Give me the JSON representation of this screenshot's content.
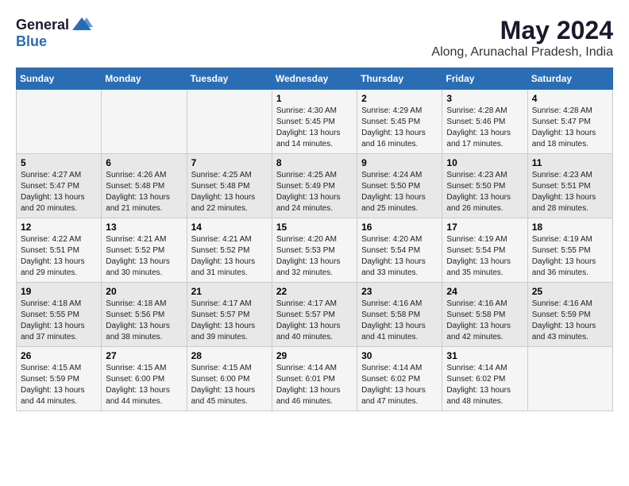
{
  "header": {
    "logo_general": "General",
    "logo_blue": "Blue",
    "month_title": "May 2024",
    "location": "Along, Arunachal Pradesh, India"
  },
  "days_of_week": [
    "Sunday",
    "Monday",
    "Tuesday",
    "Wednesday",
    "Thursday",
    "Friday",
    "Saturday"
  ],
  "weeks": [
    {
      "days": [
        {
          "number": "",
          "sunrise": "",
          "sunset": "",
          "daylight": ""
        },
        {
          "number": "",
          "sunrise": "",
          "sunset": "",
          "daylight": ""
        },
        {
          "number": "",
          "sunrise": "",
          "sunset": "",
          "daylight": ""
        },
        {
          "number": "1",
          "sunrise": "Sunrise: 4:30 AM",
          "sunset": "Sunset: 5:45 PM",
          "daylight": "Daylight: 13 hours and 14 minutes."
        },
        {
          "number": "2",
          "sunrise": "Sunrise: 4:29 AM",
          "sunset": "Sunset: 5:45 PM",
          "daylight": "Daylight: 13 hours and 16 minutes."
        },
        {
          "number": "3",
          "sunrise": "Sunrise: 4:28 AM",
          "sunset": "Sunset: 5:46 PM",
          "daylight": "Daylight: 13 hours and 17 minutes."
        },
        {
          "number": "4",
          "sunrise": "Sunrise: 4:28 AM",
          "sunset": "Sunset: 5:47 PM",
          "daylight": "Daylight: 13 hours and 18 minutes."
        }
      ]
    },
    {
      "days": [
        {
          "number": "5",
          "sunrise": "Sunrise: 4:27 AM",
          "sunset": "Sunset: 5:47 PM",
          "daylight": "Daylight: 13 hours and 20 minutes."
        },
        {
          "number": "6",
          "sunrise": "Sunrise: 4:26 AM",
          "sunset": "Sunset: 5:48 PM",
          "daylight": "Daylight: 13 hours and 21 minutes."
        },
        {
          "number": "7",
          "sunrise": "Sunrise: 4:25 AM",
          "sunset": "Sunset: 5:48 PM",
          "daylight": "Daylight: 13 hours and 22 minutes."
        },
        {
          "number": "8",
          "sunrise": "Sunrise: 4:25 AM",
          "sunset": "Sunset: 5:49 PM",
          "daylight": "Daylight: 13 hours and 24 minutes."
        },
        {
          "number": "9",
          "sunrise": "Sunrise: 4:24 AM",
          "sunset": "Sunset: 5:50 PM",
          "daylight": "Daylight: 13 hours and 25 minutes."
        },
        {
          "number": "10",
          "sunrise": "Sunrise: 4:23 AM",
          "sunset": "Sunset: 5:50 PM",
          "daylight": "Daylight: 13 hours and 26 minutes."
        },
        {
          "number": "11",
          "sunrise": "Sunrise: 4:23 AM",
          "sunset": "Sunset: 5:51 PM",
          "daylight": "Daylight: 13 hours and 28 minutes."
        }
      ]
    },
    {
      "days": [
        {
          "number": "12",
          "sunrise": "Sunrise: 4:22 AM",
          "sunset": "Sunset: 5:51 PM",
          "daylight": "Daylight: 13 hours and 29 minutes."
        },
        {
          "number": "13",
          "sunrise": "Sunrise: 4:21 AM",
          "sunset": "Sunset: 5:52 PM",
          "daylight": "Daylight: 13 hours and 30 minutes."
        },
        {
          "number": "14",
          "sunrise": "Sunrise: 4:21 AM",
          "sunset": "Sunset: 5:52 PM",
          "daylight": "Daylight: 13 hours and 31 minutes."
        },
        {
          "number": "15",
          "sunrise": "Sunrise: 4:20 AM",
          "sunset": "Sunset: 5:53 PM",
          "daylight": "Daylight: 13 hours and 32 minutes."
        },
        {
          "number": "16",
          "sunrise": "Sunrise: 4:20 AM",
          "sunset": "Sunset: 5:54 PM",
          "daylight": "Daylight: 13 hours and 33 minutes."
        },
        {
          "number": "17",
          "sunrise": "Sunrise: 4:19 AM",
          "sunset": "Sunset: 5:54 PM",
          "daylight": "Daylight: 13 hours and 35 minutes."
        },
        {
          "number": "18",
          "sunrise": "Sunrise: 4:19 AM",
          "sunset": "Sunset: 5:55 PM",
          "daylight": "Daylight: 13 hours and 36 minutes."
        }
      ]
    },
    {
      "days": [
        {
          "number": "19",
          "sunrise": "Sunrise: 4:18 AM",
          "sunset": "Sunset: 5:55 PM",
          "daylight": "Daylight: 13 hours and 37 minutes."
        },
        {
          "number": "20",
          "sunrise": "Sunrise: 4:18 AM",
          "sunset": "Sunset: 5:56 PM",
          "daylight": "Daylight: 13 hours and 38 minutes."
        },
        {
          "number": "21",
          "sunrise": "Sunrise: 4:17 AM",
          "sunset": "Sunset: 5:57 PM",
          "daylight": "Daylight: 13 hours and 39 minutes."
        },
        {
          "number": "22",
          "sunrise": "Sunrise: 4:17 AM",
          "sunset": "Sunset: 5:57 PM",
          "daylight": "Daylight: 13 hours and 40 minutes."
        },
        {
          "number": "23",
          "sunrise": "Sunrise: 4:16 AM",
          "sunset": "Sunset: 5:58 PM",
          "daylight": "Daylight: 13 hours and 41 minutes."
        },
        {
          "number": "24",
          "sunrise": "Sunrise: 4:16 AM",
          "sunset": "Sunset: 5:58 PM",
          "daylight": "Daylight: 13 hours and 42 minutes."
        },
        {
          "number": "25",
          "sunrise": "Sunrise: 4:16 AM",
          "sunset": "Sunset: 5:59 PM",
          "daylight": "Daylight: 13 hours and 43 minutes."
        }
      ]
    },
    {
      "days": [
        {
          "number": "26",
          "sunrise": "Sunrise: 4:15 AM",
          "sunset": "Sunset: 5:59 PM",
          "daylight": "Daylight: 13 hours and 44 minutes."
        },
        {
          "number": "27",
          "sunrise": "Sunrise: 4:15 AM",
          "sunset": "Sunset: 6:00 PM",
          "daylight": "Daylight: 13 hours and 44 minutes."
        },
        {
          "number": "28",
          "sunrise": "Sunrise: 4:15 AM",
          "sunset": "Sunset: 6:00 PM",
          "daylight": "Daylight: 13 hours and 45 minutes."
        },
        {
          "number": "29",
          "sunrise": "Sunrise: 4:14 AM",
          "sunset": "Sunset: 6:01 PM",
          "daylight": "Daylight: 13 hours and 46 minutes."
        },
        {
          "number": "30",
          "sunrise": "Sunrise: 4:14 AM",
          "sunset": "Sunset: 6:02 PM",
          "daylight": "Daylight: 13 hours and 47 minutes."
        },
        {
          "number": "31",
          "sunrise": "Sunrise: 4:14 AM",
          "sunset": "Sunset: 6:02 PM",
          "daylight": "Daylight: 13 hours and 48 minutes."
        },
        {
          "number": "",
          "sunrise": "",
          "sunset": "",
          "daylight": ""
        }
      ]
    }
  ]
}
